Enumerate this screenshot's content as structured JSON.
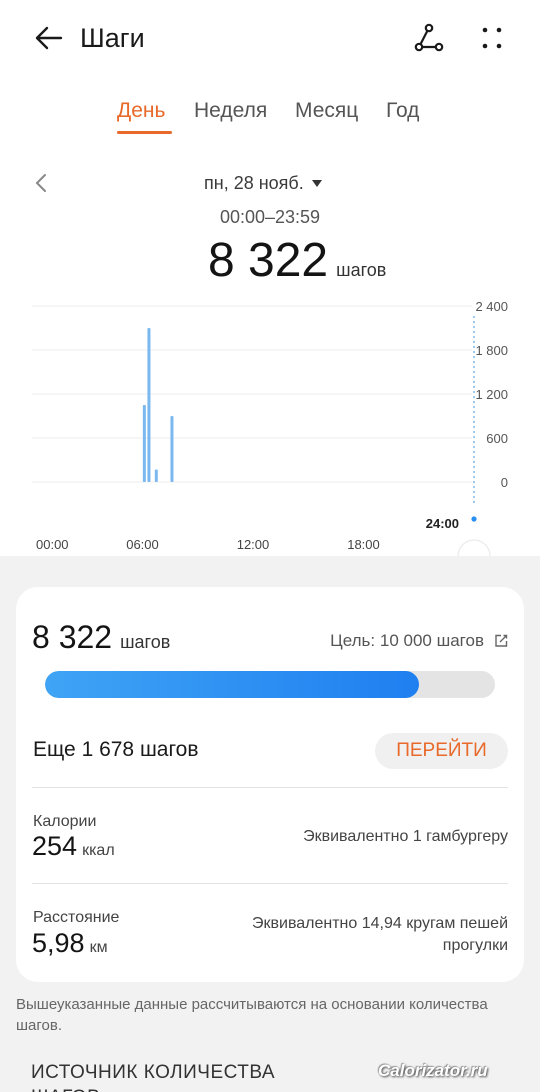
{
  "header": {
    "title": "Шаги",
    "back_icon": "arrow-left-icon",
    "route_icon": "route-icon",
    "more_icon": "more-dots-icon"
  },
  "tabs": [
    {
      "label": "День",
      "active": true
    },
    {
      "label": "Неделя",
      "active": false
    },
    {
      "label": "Месяц",
      "active": false
    },
    {
      "label": "Год",
      "active": false
    }
  ],
  "date": {
    "label": "пн, 28 нояб.",
    "time_range": "00:00–23:59"
  },
  "total": {
    "value": "8 322",
    "unit": "шагов"
  },
  "colors": {
    "accent": "#e8692a",
    "bar": "#7ab8ef",
    "progress": "#2a8ff2"
  },
  "chart_data": {
    "type": "bar",
    "x_ticks": [
      "00:00",
      "06:00",
      "12:00",
      "18:00"
    ],
    "x_end_label": "24:00",
    "y_ticks": [
      "2 400",
      "1 800",
      "1 200",
      "600",
      "0"
    ],
    "ylim": [
      0,
      2400
    ],
    "grid": true,
    "bars": [
      {
        "hour": 6.1,
        "value": 1050
      },
      {
        "hour": 6.35,
        "value": 2100
      },
      {
        "hour": 6.75,
        "value": 170
      },
      {
        "hour": 7.6,
        "value": 900
      }
    ]
  },
  "card": {
    "steps": "8 322",
    "steps_unit": "шагов",
    "goal": "Цель: 10 000 шагов",
    "edit_icon": "edit-icon",
    "progress": 0.8322,
    "remaining": "Еще 1 678 шагов",
    "go_button": "ПЕРЕЙТИ",
    "calories": {
      "label": "Калории",
      "value": "254",
      "unit": "ккал",
      "note": "Эквивалентно 1 гамбургеру"
    },
    "distance": {
      "label": "Расстояние",
      "value": "5,98",
      "unit": "км",
      "note": "Эквивалентно 14,94 кругам пешей прогулки"
    }
  },
  "footnote": "Вышеуказанные данные рассчитываются на основании количества шагов.",
  "source_heading": "ИСТОЧНИК КОЛИЧЕСТВА ШАГОВ",
  "watermark": "Calorizator.ru"
}
